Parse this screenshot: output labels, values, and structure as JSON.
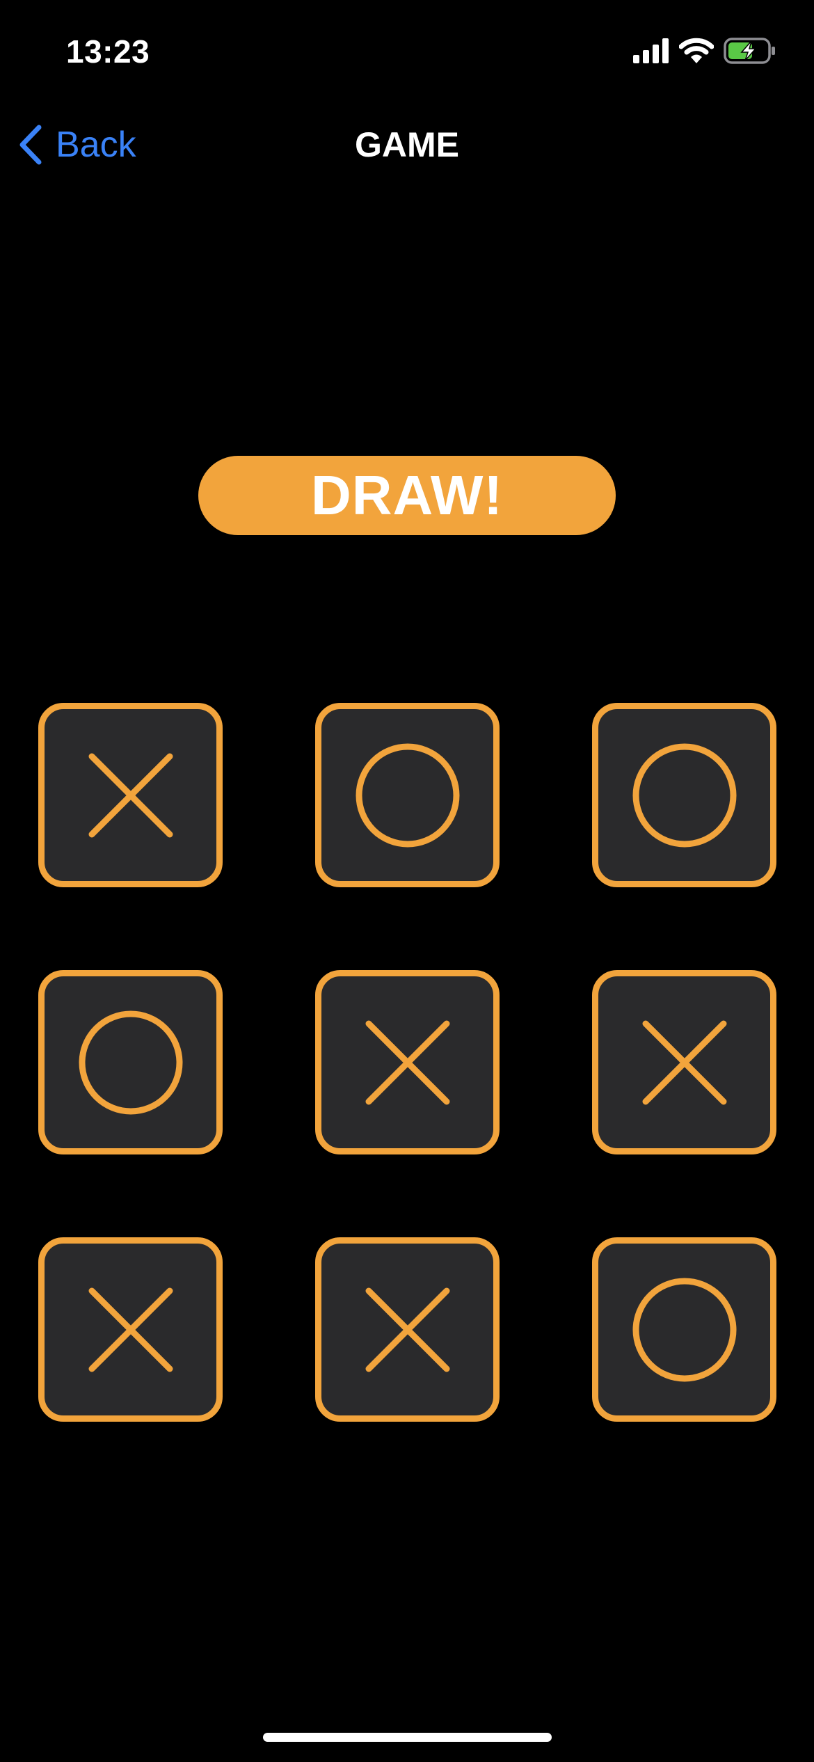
{
  "status_bar": {
    "time": "13:23",
    "icons": [
      "cellular-signal-icon",
      "wifi-icon",
      "battery-charging-icon"
    ]
  },
  "nav": {
    "back_label": "Back",
    "title": "GAME"
  },
  "result": {
    "text": "DRAW!"
  },
  "board": {
    "cells": [
      "X",
      "O",
      "O",
      "O",
      "X",
      "X",
      "X",
      "X",
      "O"
    ]
  },
  "colors": {
    "accent": "#f2a43c",
    "link": "#3a82f7",
    "cell_background": "#2a2a2c",
    "battery_green": "#5ac846",
    "background": "#000000"
  }
}
